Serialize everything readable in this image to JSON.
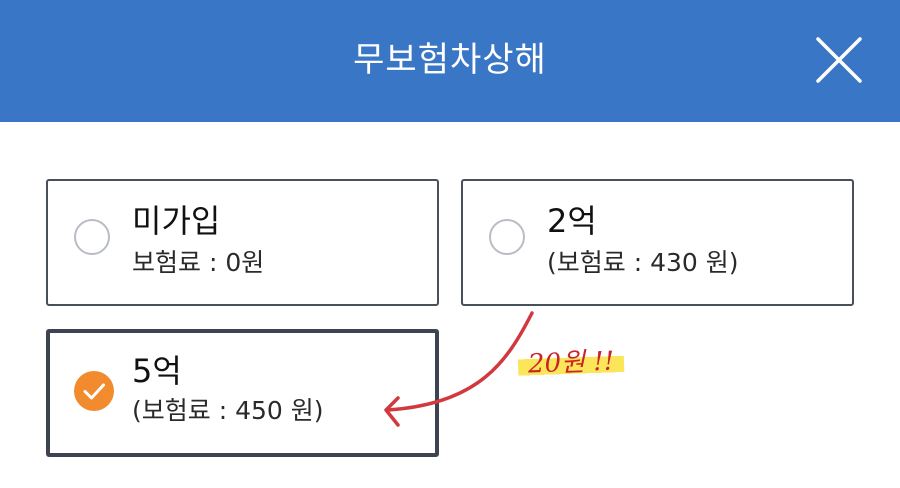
{
  "header": {
    "title": "무보험차상해",
    "close_icon": "close-icon",
    "background_color": "#3a76c6"
  },
  "options": [
    {
      "label": "미가입",
      "price": "보험료 : 0원",
      "selected": false
    },
    {
      "label": "2억",
      "price": "(보험료 : 430 원)",
      "selected": false
    },
    {
      "label": "5억",
      "price": "(보험료 : 450 원)",
      "selected": true
    }
  ],
  "annotation": {
    "text": "20원 !!",
    "color": "#c8242a",
    "highlight_color": "#fae13c"
  },
  "colors": {
    "selected_radio": "#f28a2e",
    "unselected_radio_border": "#b8bdc4"
  }
}
